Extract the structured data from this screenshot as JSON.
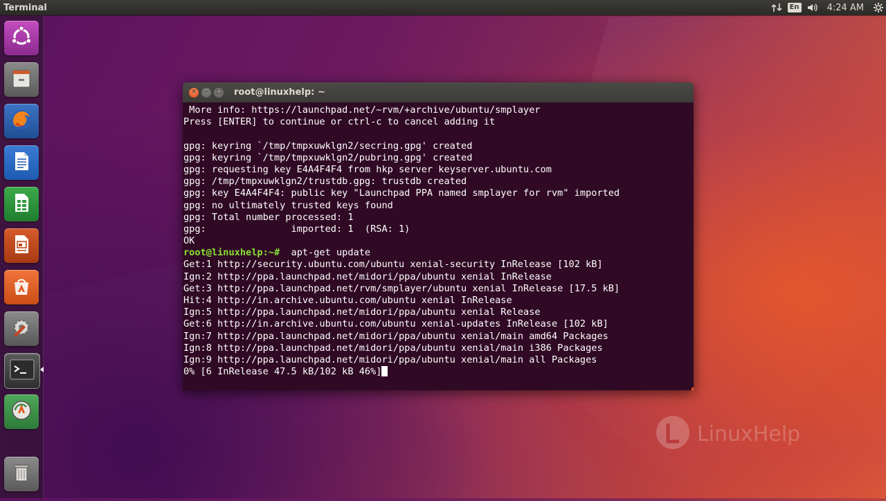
{
  "top_panel": {
    "app_title": "Terminal",
    "keyboard_layout": "En",
    "clock": "4:24 AM"
  },
  "launcher": {
    "items": [
      {
        "name": "ubuntu-dash",
        "icon": "ubuntu-logo-icon"
      },
      {
        "name": "files",
        "icon": "file-cabinet-icon"
      },
      {
        "name": "firefox",
        "icon": "firefox-icon"
      },
      {
        "name": "libreoffice-writer",
        "icon": "writer-document-icon"
      },
      {
        "name": "libreoffice-calc",
        "icon": "calc-spreadsheet-icon"
      },
      {
        "name": "libreoffice-impress",
        "icon": "impress-presentation-icon"
      },
      {
        "name": "ubuntu-software",
        "icon": "software-bag-icon"
      },
      {
        "name": "system-settings",
        "icon": "settings-wrench-gear-icon"
      },
      {
        "name": "terminal",
        "icon": "terminal-icon"
      },
      {
        "name": "software-updater",
        "icon": "updater-icon"
      },
      {
        "name": "trash",
        "icon": "trash-icon"
      }
    ]
  },
  "window": {
    "title": "root@linuxhelp: ~"
  },
  "terminal": {
    "lines": [
      " More info: https://launchpad.net/~rvm/+archive/ubuntu/smplayer",
      "Press [ENTER] to continue or ctrl-c to cancel adding it",
      "",
      "gpg: keyring `/tmp/tmpxuwklgn2/secring.gpg' created",
      "gpg: keyring `/tmp/tmpxuwklgn2/pubring.gpg' created",
      "gpg: requesting key E4A4F4F4 from hkp server keyserver.ubuntu.com",
      "gpg: /tmp/tmpxuwklgn2/trustdb.gpg: trustdb created",
      "gpg: key E4A4F4F4: public key \"Launchpad PPA named smplayer for rvm\" imported",
      "gpg: no ultimately trusted keys found",
      "gpg: Total number processed: 1",
      "gpg:               imported: 1  (RSA: 1)",
      "OK"
    ],
    "prompt": "root@linuxhelp:~#",
    "command": "  apt-get update",
    "output": [
      "Get:1 http://security.ubuntu.com/ubuntu xenial-security InRelease [102 kB]",
      "Ign:2 http://ppa.launchpad.net/midori/ppa/ubuntu xenial InRelease",
      "Get:3 http://ppa.launchpad.net/rvm/smplayer/ubuntu xenial InRelease [17.5 kB]",
      "Hit:4 http://in.archive.ubuntu.com/ubuntu xenial InRelease",
      "Ign:5 http://ppa.launchpad.net/midori/ppa/ubuntu xenial Release",
      "Get:6 http://in.archive.ubuntu.com/ubuntu xenial-updates InRelease [102 kB]",
      "Ign:7 http://ppa.launchpad.net/midori/ppa/ubuntu xenial/main amd64 Packages",
      "Ign:8 http://ppa.launchpad.net/midori/ppa/ubuntu xenial/main i386 Packages",
      "Ign:9 http://ppa.launchpad.net/midori/ppa/ubuntu xenial/main all Packages"
    ],
    "progress": "0% [6 InRelease 47.5 kB/102 kB 46%]"
  },
  "watermark": {
    "text": "LinuxHelp"
  },
  "colors": {
    "terminal_bg": "#300a24",
    "prompt_green": "#8ae234",
    "ubuntu_orange": "#e95420",
    "panel_bg": "#3c3b37"
  }
}
